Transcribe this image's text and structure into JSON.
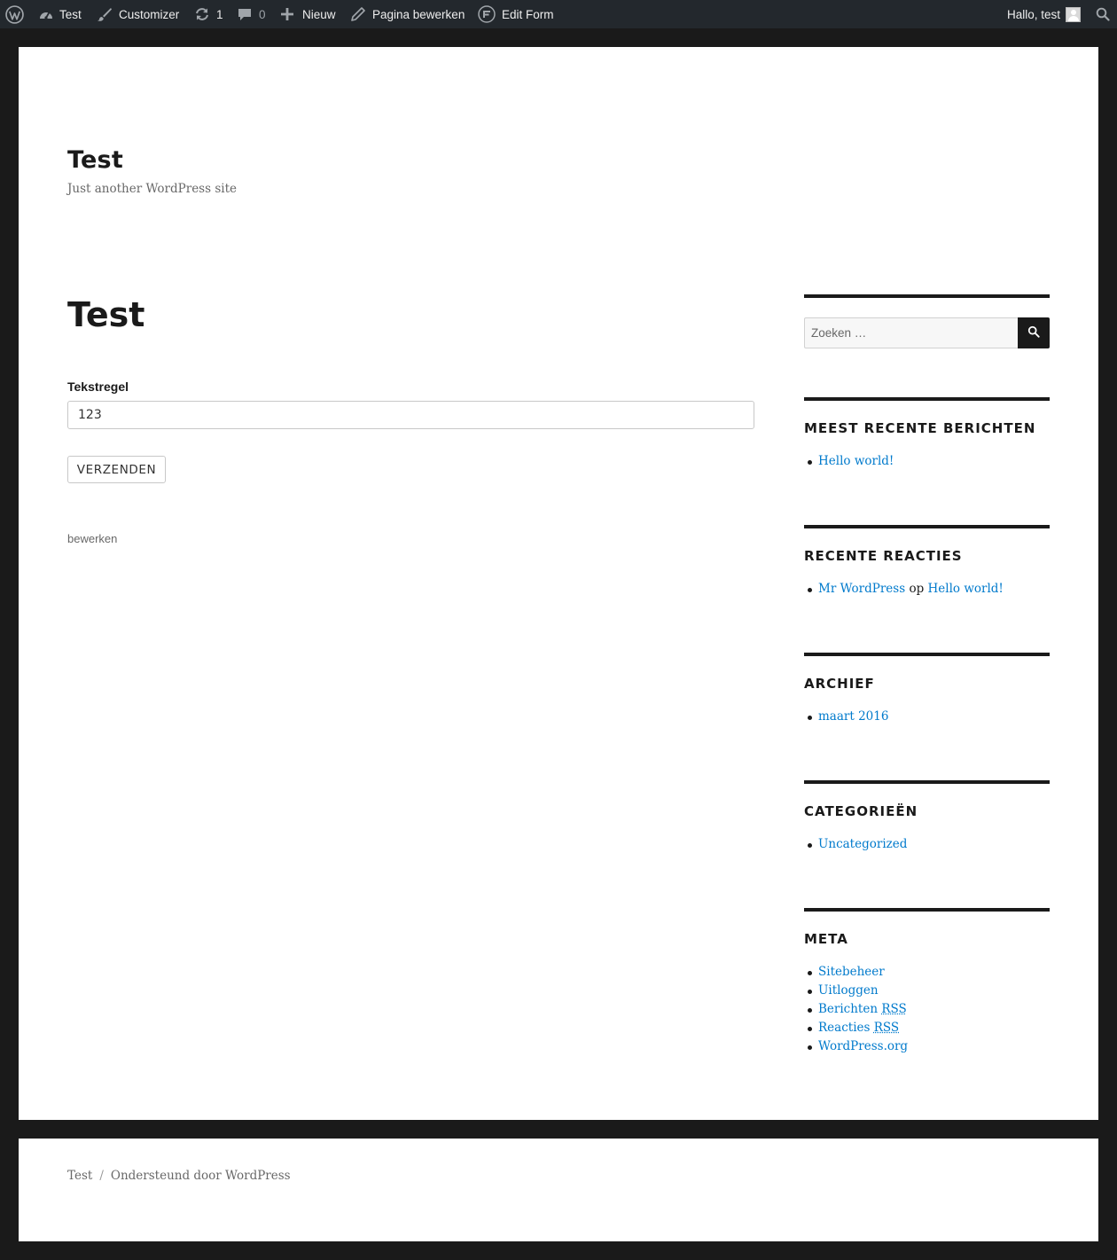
{
  "admin_bar": {
    "site": "Test",
    "customizer": "Customizer",
    "updates_count": "1",
    "comments_count": "0",
    "new": "Nieuw",
    "edit_page": "Pagina bewerken",
    "edit_form": "Edit Form",
    "greeting": "Hallo, test"
  },
  "header": {
    "site_title": "Test",
    "tagline": "Just another WordPress site"
  },
  "content": {
    "page_title": "Test",
    "form": {
      "field_label": "Tekstregel",
      "field_value": "123",
      "submit_label": "VERZENDEN"
    },
    "edit_link": "bewerken"
  },
  "sidebar": {
    "search": {
      "placeholder": "Zoeken …"
    },
    "recent_posts": {
      "title": "MEEST RECENTE BERICHTEN",
      "items": [
        "Hello world!"
      ]
    },
    "recent_comments": {
      "title": "RECENTE REACTIES",
      "author": "Mr WordPress",
      "joiner": "op",
      "post": "Hello world!"
    },
    "archives": {
      "title": "ARCHIEF",
      "items": [
        "maart 2016"
      ]
    },
    "categories": {
      "title": "CATEGORIEËN",
      "items": [
        "Uncategorized"
      ]
    },
    "meta": {
      "title": "META",
      "items": [
        "Sitebeheer",
        "Uitloggen"
      ],
      "entries_prefix": "Berichten",
      "comments_prefix": "Reacties",
      "rss": "RSS",
      "wordpress_org": "WordPress.org"
    }
  },
  "footer": {
    "site": "Test",
    "separator": "/",
    "powered": "Ondersteund door WordPress"
  }
}
